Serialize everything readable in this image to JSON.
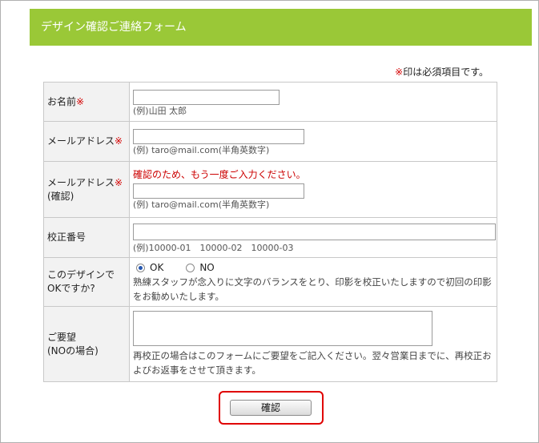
{
  "header": {
    "title": "デザイン確認ご連絡フォーム"
  },
  "required_note": {
    "mark": "※",
    "text": "印は必須項目です。"
  },
  "required_mark": "※",
  "fields": {
    "name": {
      "label": "お名前",
      "value": "",
      "example": "(例)山田 太郎"
    },
    "email": {
      "label": "メールアドレス",
      "value": "",
      "example": "(例) taro@mail.com(半角英数字)"
    },
    "email_confirm": {
      "label_line1": "メールアドレス",
      "label_line2": "(確認)",
      "warning": "確認のため、もう一度ご入力ください。",
      "value": "",
      "example": "(例) taro@mail.com(半角英数字)"
    },
    "proof_number": {
      "label": "校正番号",
      "value": "",
      "example": "(例)10000-01　10000-02　10000-03"
    },
    "design_ok": {
      "label_line1": "このデザインで",
      "label_line2": "OKですか?",
      "options": [
        "OK",
        "NO"
      ],
      "selected": "OK",
      "description": "熟練スタッフが念入りに文字のバランスをとり、印影を校正いたしますので初回の印影をお勧めいたします。"
    },
    "request": {
      "label_line1": "ご要望",
      "label_line2": "(NOの場合)",
      "value": "",
      "description": "再校正の場合はこのフォームにご要望をご記入ください。翌々営業日までに、再校正およびお返事をさせて頂きます。"
    }
  },
  "confirm_button": {
    "label": "確認"
  },
  "colors": {
    "header_bg": "#9ac837",
    "required": "#d40000",
    "highlight_border": "#e00000"
  }
}
